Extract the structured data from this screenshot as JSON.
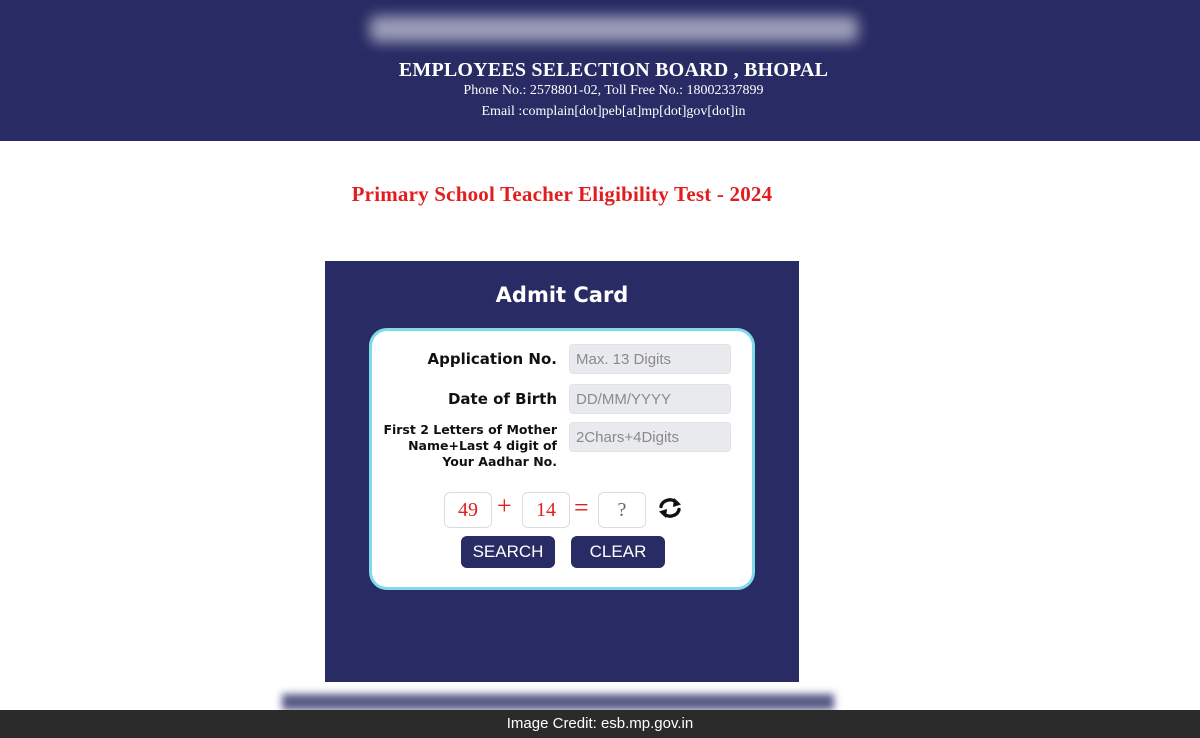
{
  "header": {
    "org_name": "EMPLOYEES SELECTION BOARD , BHOPAL",
    "phone_line": "Phone No.: 2578801-02, Toll Free No.: 18002337899",
    "email_line": "Email :complain[dot]peb[at]mp[dot]gov[dot]in"
  },
  "exam_title": "Primary School Teacher Eligibility Test - 2024",
  "admit_card": {
    "heading": "Admit Card",
    "fields": {
      "application_no": {
        "label": "Application No.",
        "placeholder": "Max. 13 Digits",
        "value": ""
      },
      "dob": {
        "label": "Date of Birth",
        "placeholder": "DD/MM/YYYY",
        "value": ""
      },
      "mother_aadhar": {
        "label": "First 2 Letters of Mother Name+Last 4 digit of Your Aadhar No.",
        "placeholder": "2Chars+4Digits",
        "value": ""
      }
    },
    "captcha": {
      "operand_a": "49",
      "operator": "+",
      "operand_b": "14",
      "equals": "=",
      "answer_placeholder": "?",
      "refresh_icon": "refresh-icon"
    },
    "buttons": {
      "search": "SEARCH",
      "clear": "CLEAR"
    }
  },
  "credit": "Image Credit: esb.mp.gov.in",
  "colors": {
    "navy": "#282b64",
    "title_red": "#e11d1d",
    "form_border": "#7fdbe8"
  }
}
